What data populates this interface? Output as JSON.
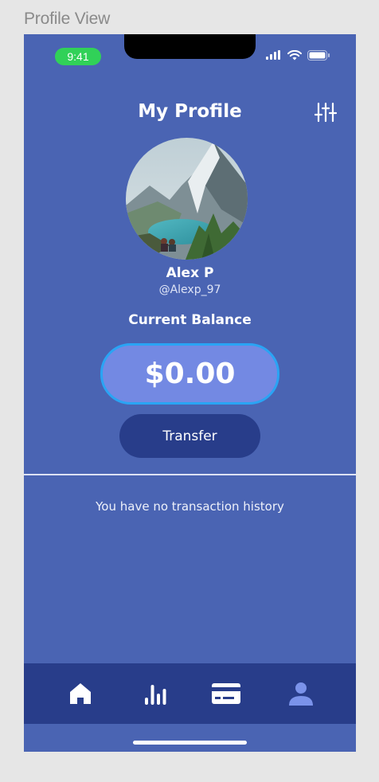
{
  "frame": {
    "label": "Profile View"
  },
  "status_bar": {
    "time": "9:41",
    "icons": [
      "signal-icon",
      "wifi-icon",
      "battery-icon"
    ]
  },
  "header": {
    "title": "My Profile",
    "action_icon": "sliders-icon"
  },
  "profile": {
    "name": "Alex P",
    "handle": "@Alexp_97",
    "avatar_icon": "mountain-lake-photo"
  },
  "balance": {
    "label": "Current Balance",
    "amount": "$0.00"
  },
  "actions": {
    "transfer_label": "Transfer"
  },
  "transactions": {
    "empty_message": "You have no transaction history"
  },
  "tabbar": {
    "items": [
      {
        "icon": "home-icon"
      },
      {
        "icon": "chart-icon"
      },
      {
        "icon": "card-icon"
      },
      {
        "icon": "user-icon",
        "active": true
      }
    ]
  },
  "colors": {
    "background": "#4a64b3",
    "dark_accent": "#283d8a",
    "balance_fill": "#7389e3",
    "balance_border": "#2aa4f4",
    "status_green": "#31d158",
    "active_tab": "#7b93ea"
  }
}
